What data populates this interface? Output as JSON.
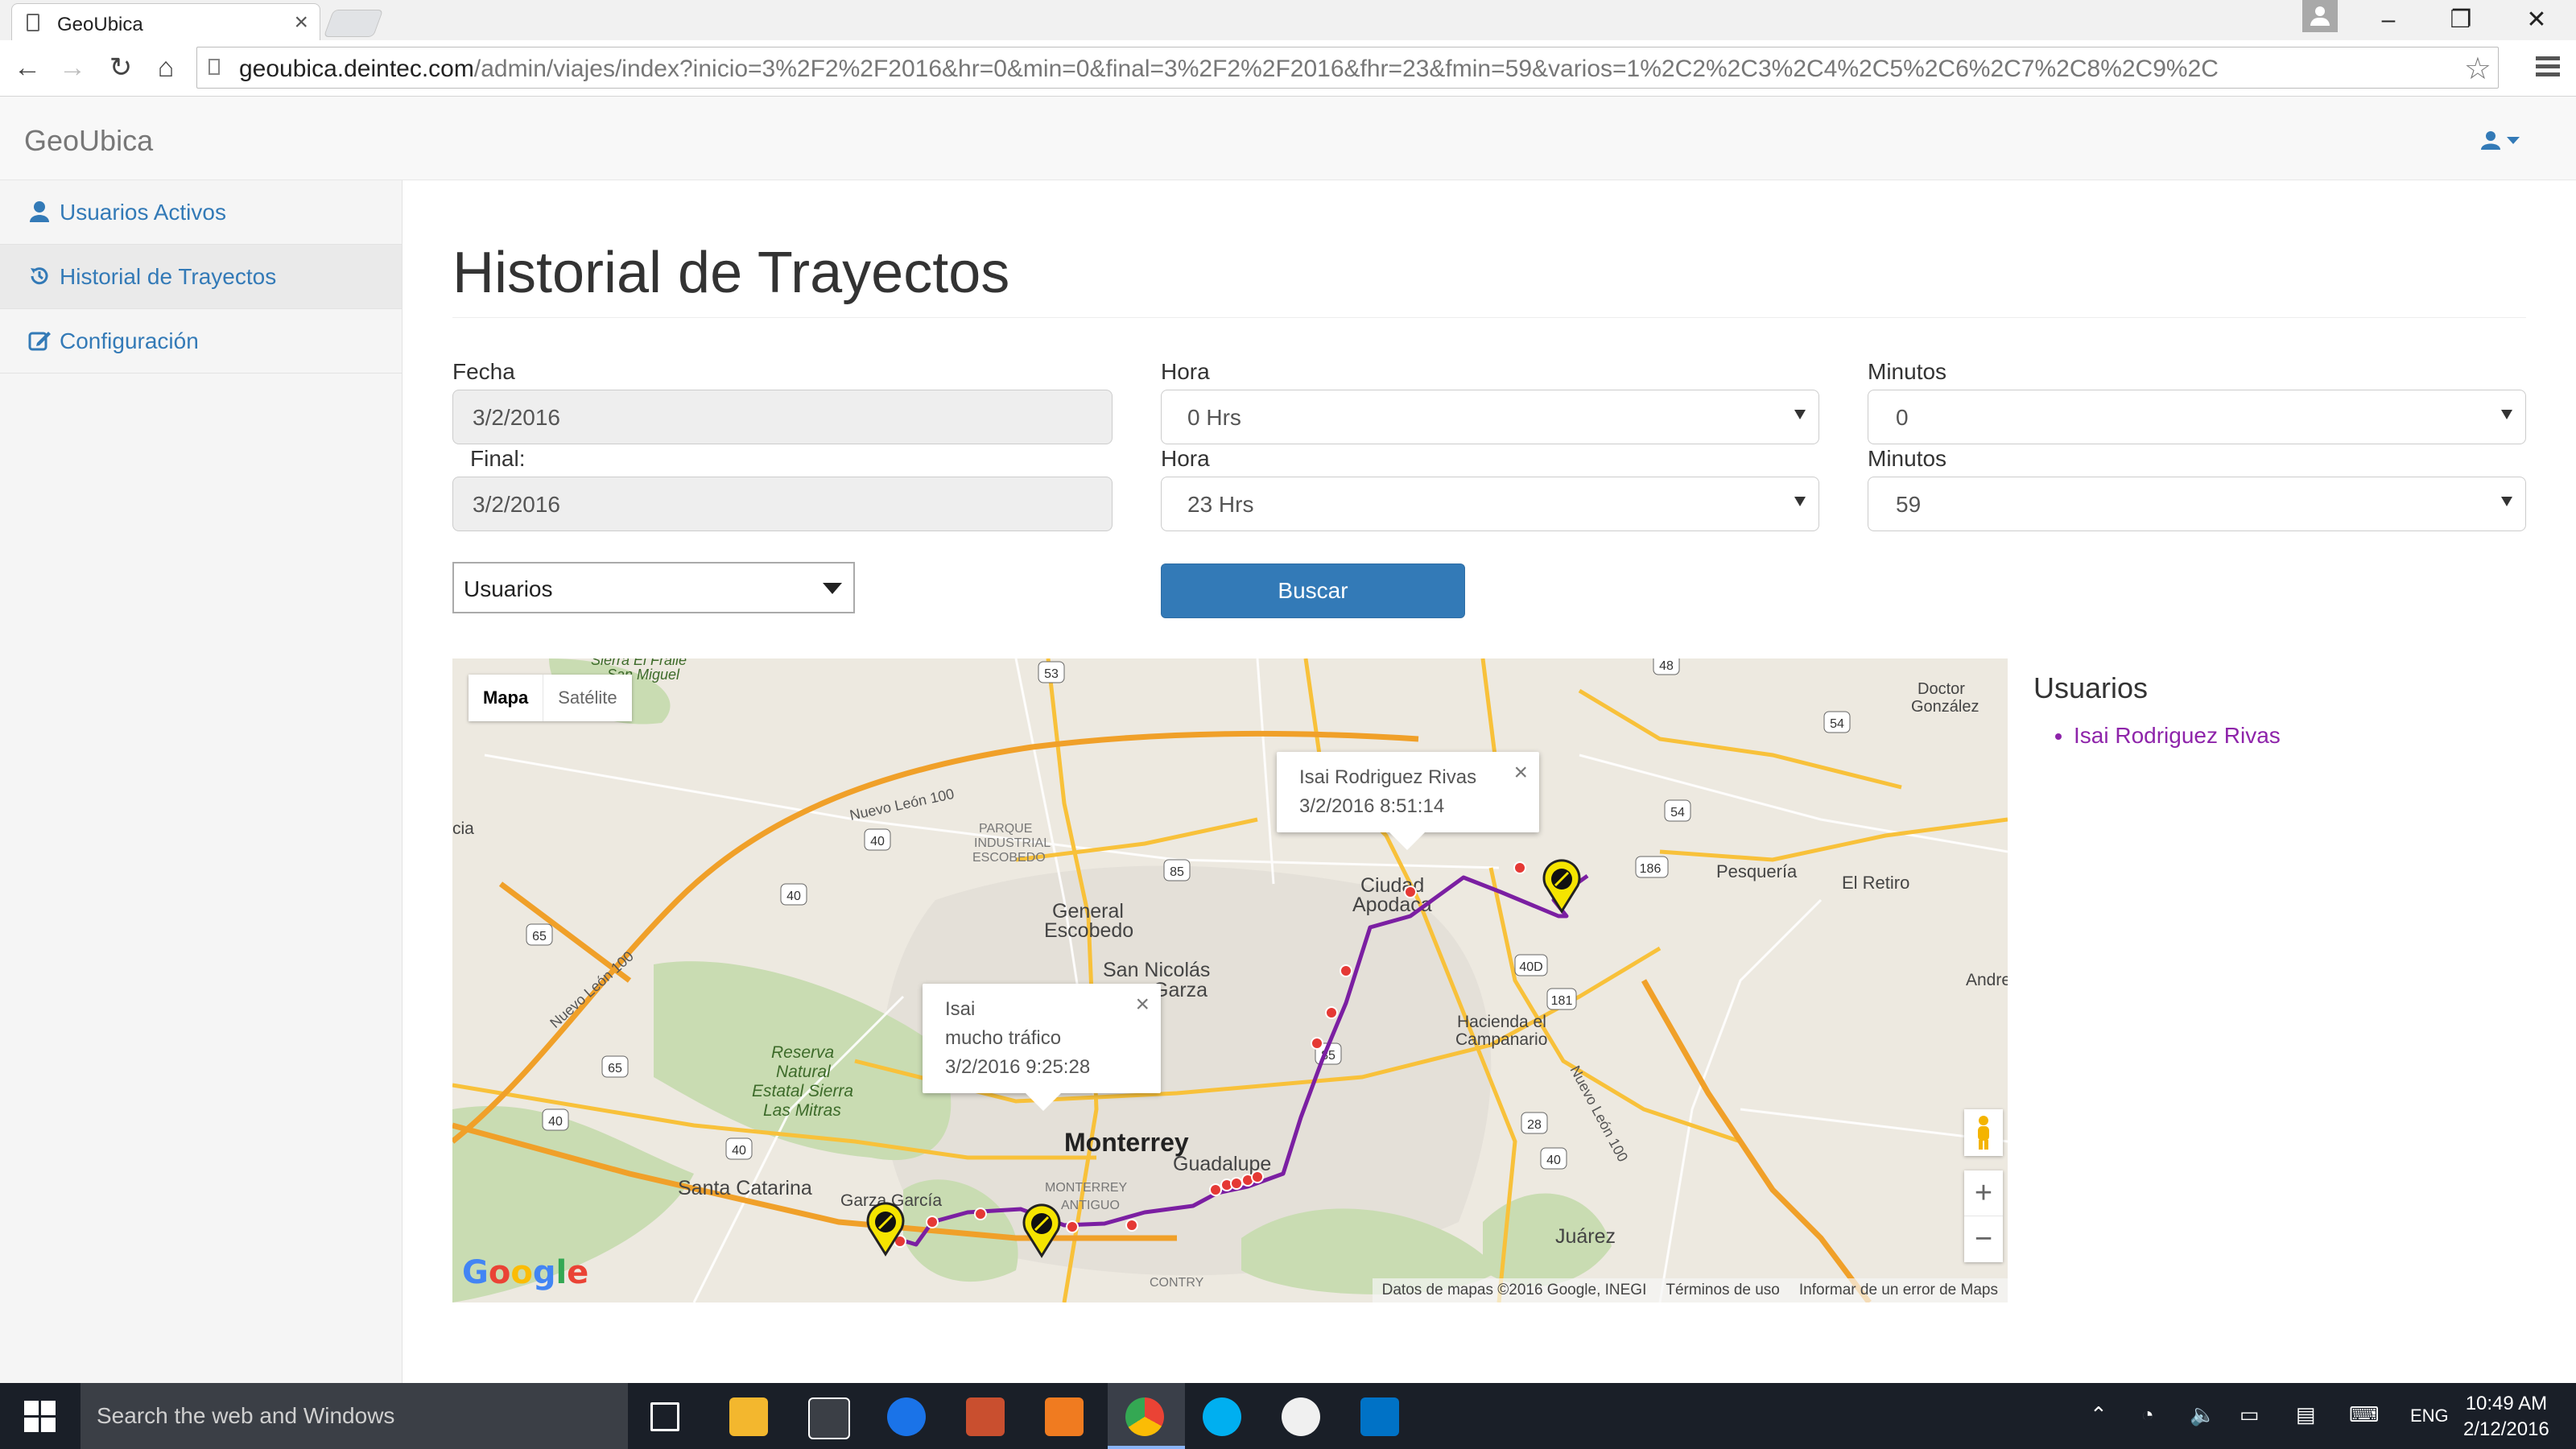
{
  "browser": {
    "tab_title": "GeoUbica",
    "url_host": "geoubica.deintec.com",
    "url_path": "/admin/viajes/index?inicio=3%2F2%2F2016&hr=0&min=0&final=3%2F2%2F2016&fhr=23&fmin=59&varios=1%2C2%2C3%2C4%2C5%2C6%2C7%2C8%2C9%2C"
  },
  "app": {
    "brand": "GeoUbica"
  },
  "sidebar": {
    "items": [
      {
        "label": "Usuarios Activos",
        "icon": "user-icon",
        "active": false
      },
      {
        "label": "Historial de Trayectos",
        "icon": "history-icon",
        "active": true
      },
      {
        "label": "Configuración",
        "icon": "edit-icon",
        "active": false
      }
    ]
  },
  "page": {
    "title": "Historial de Trayectos"
  },
  "form": {
    "fecha_label": "Fecha",
    "fecha_value": "3/2/2016",
    "final_label": "Final:",
    "final_value": "3/2/2016",
    "hora_label": "Hora",
    "hora_inicio": "0 Hrs",
    "hora_final": "23 Hrs",
    "minutos_label": "Minutos",
    "min_inicio": "0",
    "min_final": "59",
    "usuarios_select": "Usuarios",
    "buscar_label": "Buscar"
  },
  "map": {
    "type_map": "Mapa",
    "type_satellite": "Satélite",
    "attribution": {
      "data": "Datos de mapas ©2016 Google, INEGI",
      "terms": "Términos de uso",
      "report": "Informar de un error de Maps"
    },
    "google": "Google",
    "labels": {
      "monterrey": "Monterrey",
      "san_nicolas": "San Nicolás",
      "garza": "Garza",
      "general_escobedo_1": "General",
      "general_escobedo_2": "Escobedo",
      "ciudad_apodaca_1": "Ciudad",
      "ciudad_apodaca_2": "Apodaca",
      "guadalupe": "Guadalupe",
      "santa_catarina": "Santa Catarina",
      "garza_garcia": "Garza García",
      "juarez": "Juárez",
      "pesqueria": "Pesquería",
      "el_retiro": "El Retiro",
      "doctor_gonzalez_1": "Doctor",
      "doctor_gonzalez_2": "González",
      "andre": "Andre",
      "hacienda_1": "Hacienda el",
      "hacienda_2": "Campanario",
      "reserva_1": "Reserva",
      "reserva_2": "Natural",
      "reserva_3": "Estatal Sierra",
      "reserva_4": "Las Mitras",
      "parque_1": "PARQUE",
      "parque_2": "INDUSTRIAL",
      "parque_3": "ESCOBEDO",
      "monterrey_antiguo_1": "MONTERREY",
      "monterrey_antiguo_2": "ANTIGUO",
      "contry": "CONTRY",
      "sierra_el_fraile": "Sierra El Fraile",
      "san_miguel": "San Miguel",
      "cia": "cia",
      "nl100_a": "Nuevo León 100",
      "nl100_b": "Nuevo León 100",
      "nl100_c": "Nuevo León 100"
    },
    "shields": [
      "53",
      "48",
      "54",
      "54",
      "186",
      "40",
      "40",
      "85",
      "65",
      "65",
      "40",
      "40",
      "40D",
      "181",
      "28",
      "40",
      "85"
    ],
    "infowindows": [
      {
        "line1": "Isai Rodriguez Rivas",
        "line2": "3/2/2016 8:51:14"
      },
      {
        "line1": "Isai",
        "line2": "mucho tráfico",
        "line3": "3/2/2016 9:25:28"
      }
    ],
    "close_symbol": "×",
    "zoom_in": "+",
    "zoom_out": "−",
    "route_color": "#7b1fa2"
  },
  "users_panel": {
    "title": "Usuarios",
    "users": [
      {
        "name": "Isai Rodriguez Rivas",
        "color": "#8e24aa"
      }
    ]
  },
  "taskbar": {
    "search_placeholder": "Search the web and Windows",
    "lang": "ENG",
    "time": "10:49 AM",
    "date": "2/12/2016"
  }
}
